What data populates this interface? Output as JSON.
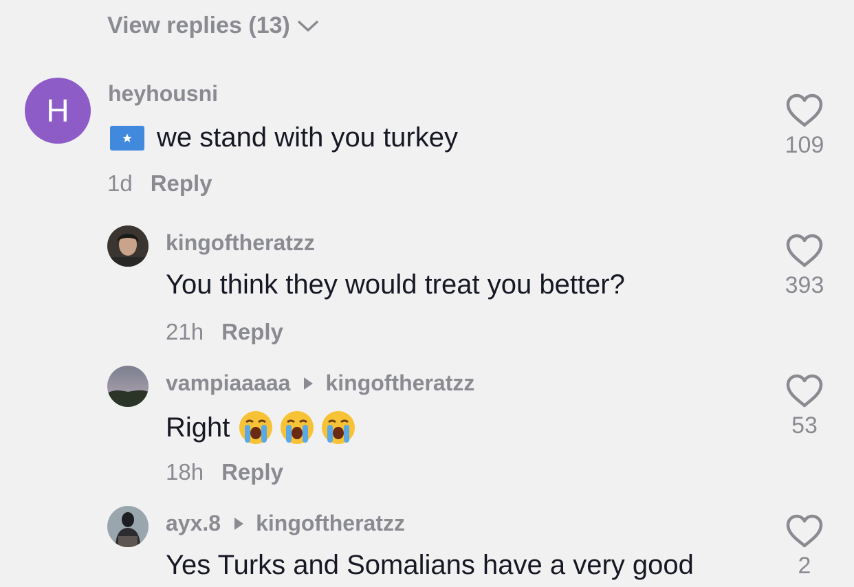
{
  "thread": {
    "view_replies_label": "View replies (13)"
  },
  "comments": [
    {
      "avatar_letter": "H",
      "username": "heyhousni",
      "text": "we stand with you turkey",
      "flag_icon": "somalia-flag-icon",
      "age": "1d",
      "reply_label": "Reply",
      "likes": "109"
    },
    {
      "username": "kingoftheratzz",
      "text": "You think they would treat you better?",
      "age": "21h",
      "reply_label": "Reply",
      "likes": "393"
    },
    {
      "username": "vampiaaaaa",
      "reply_to": "kingoftheratzz",
      "text": "Right",
      "emoji_icon": "loudly-crying-face-icon",
      "age": "18h",
      "reply_label": "Reply",
      "likes": "53"
    },
    {
      "username": "ayx.8",
      "reply_to": "kingoftheratzz",
      "text": "Yes Turks and Somalians have a very good",
      "likes": "2"
    }
  ],
  "colors": {
    "background": "#f2f1f2",
    "avatar_purple": "#8e5cc7",
    "muted_text": "#8a8b91",
    "primary_text": "#161823"
  }
}
